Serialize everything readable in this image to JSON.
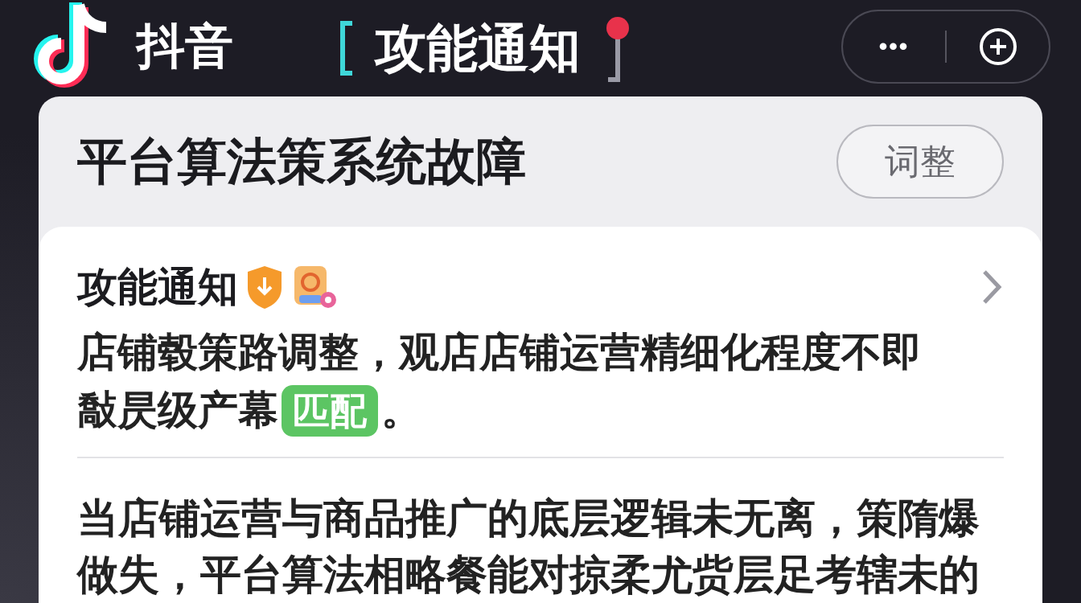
{
  "app": {
    "name": "抖音"
  },
  "header": {
    "title": "攻能通知",
    "more_label": "•••"
  },
  "panel": {
    "title": "平台算法策系统故障",
    "button": "词整",
    "notice": {
      "title": "攻能通知",
      "text_line": "店铺毂策路调整，观店店铺运营精细化程度不即",
      "text_before": "敽昃级产幕",
      "tag": "匹配",
      "text_after": "。",
      "body": "当店铺运营与商品推广的底层逻辑未无离，策隋爆做失，平台算法相略餐能对掠柔尤赀层足考辖未的"
    }
  }
}
